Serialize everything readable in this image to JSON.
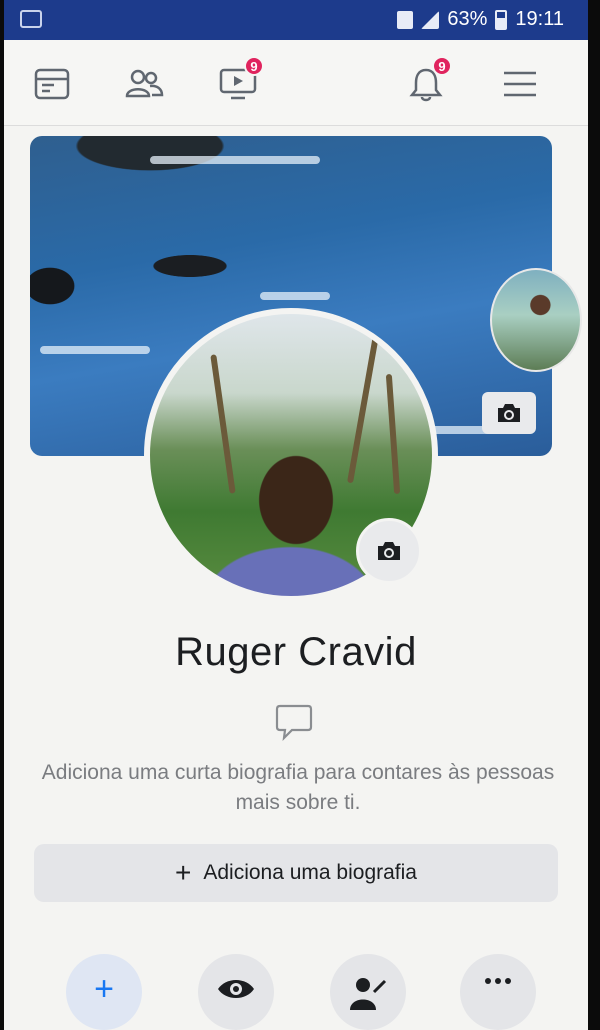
{
  "status_bar": {
    "battery": "63%",
    "time": "19:11"
  },
  "nav": {
    "video_badge": "9",
    "notifications_badge": "9"
  },
  "profile": {
    "name": "Ruger Cravid",
    "bio_hint": "Adiciona uma curta biografia para contares às pessoas mais sobre ti.",
    "add_bio_label": "Adiciona uma biografia"
  },
  "icons": {
    "feed": "news-feed-icon",
    "friends": "friends-icon",
    "watch": "video-watch-icon",
    "notifications": "bell-icon",
    "menu": "hamburger-menu-icon",
    "camera": "camera-icon",
    "bio": "speech-bubble-icon",
    "add": "plus-icon",
    "view_as": "eye-icon",
    "edit_profile": "edit-person-icon",
    "more": "more-icon"
  },
  "colors": {
    "accent": "#1877f2",
    "status_bar": "#1d3b8c",
    "badge": "#e0245e"
  }
}
